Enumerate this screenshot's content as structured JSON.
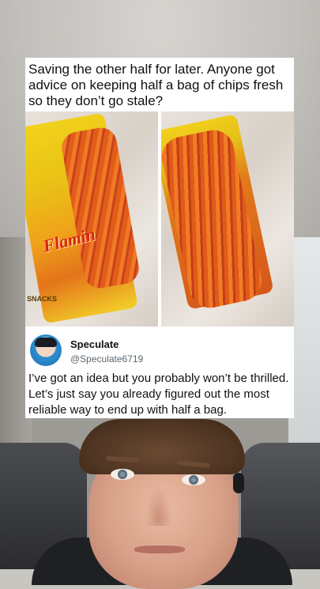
{
  "post": {
    "text": "Saving the other half for later. Anyone got advice on keeping half a bag of chips fresh so they don’t go stale?",
    "left_image": {
      "bag_brand": "Flamin",
      "bag_small_text": "SNACKS"
    }
  },
  "reply": {
    "display_name": "Speculate",
    "handle": "@Speculate6719",
    "text": "I’ve got an idea but you probably won’t be thrilled. Let’s just say you already figured out the most reliable way to end up with half a bag."
  }
}
